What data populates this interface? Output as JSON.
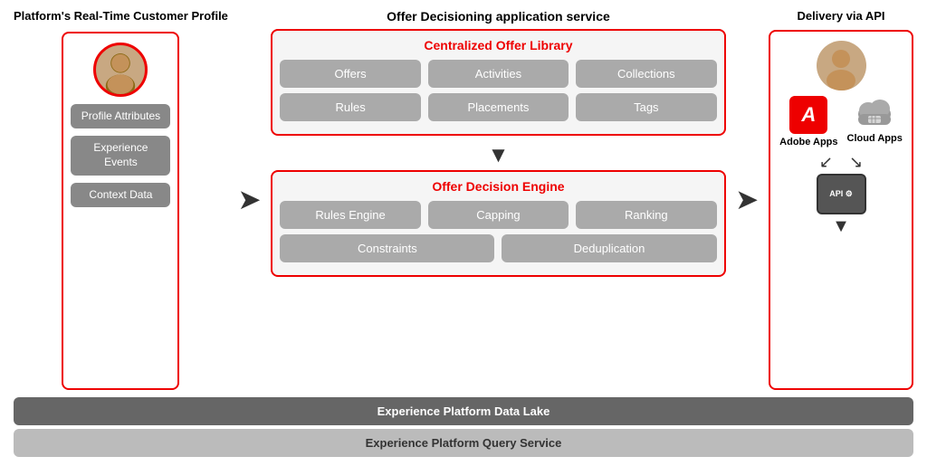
{
  "leftColumn": {
    "title": "Platform's Real-Time Customer Profile",
    "attributes": [
      "Profile Attributes",
      "Experience Events",
      "Context Data"
    ]
  },
  "middleColumn": {
    "title": "Offer Decisioning application service",
    "library": {
      "title": "Centralized Offer Library",
      "row1": [
        "Offers",
        "Activities",
        "Collections"
      ],
      "row2": [
        "Rules",
        "Placements",
        "Tags"
      ]
    },
    "engine": {
      "title": "Offer Decision Engine",
      "row1": [
        "Rules Engine",
        "Capping",
        "Ranking"
      ],
      "row2": [
        "Constraints",
        "Deduplication"
      ]
    }
  },
  "rightColumn": {
    "title": "Delivery via API",
    "adobeAppsLabel": "Adobe Apps",
    "cloudAppsLabel": "Cloud Apps"
  },
  "bottomBars": {
    "bar1": "Experience Platform Data Lake",
    "bar2": "Experience Platform Query Service"
  }
}
